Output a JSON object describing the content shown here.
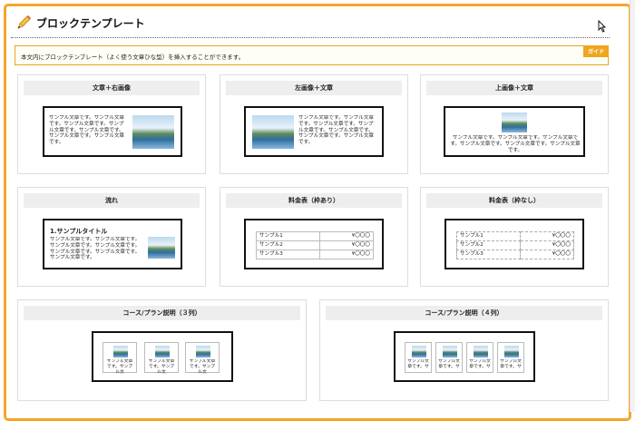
{
  "header": {
    "title": "ブロックテンプレート",
    "pencil_icon": "pencil-icon"
  },
  "guide": {
    "text": "本文内にブロックテンプレート（よく使う文章ひな型）を挿入することができます。",
    "badge": "ガイド"
  },
  "sample_text_long": "サンプル文章です。サンプル文章です。サンプル文章です。サンプル文章です。サンプル文章です。サンプル文章です。サンプル文章です。",
  "sample_text_wide": "サンプル文章です。サンプル文章です。サンプル文章です。サンプル文章です。サンプル文章です。サンプル文章です。",
  "cards": [
    {
      "title": "文章＋右画像"
    },
    {
      "title": "左画像＋文章"
    },
    {
      "title": "上画像＋文章"
    },
    {
      "title": "流れ",
      "heading": "1.サンプルタイトル"
    },
    {
      "title": "料金表（枠あり）"
    },
    {
      "title": "料金表（枠なし）"
    },
    {
      "title": "コース/プラン説明（３列）",
      "mini_text": "サンプル文章です。サンプル文"
    },
    {
      "title": "コース/プラン説明（４列）",
      "mini_text": "サンプル文章です。サ"
    }
  ],
  "price_rows": [
    {
      "name": "サンプル1",
      "price": "¥〇〇〇"
    },
    {
      "name": "サンプル2",
      "price": "¥〇〇〇"
    },
    {
      "name": "サンプル3",
      "price": "¥〇〇〇"
    }
  ]
}
